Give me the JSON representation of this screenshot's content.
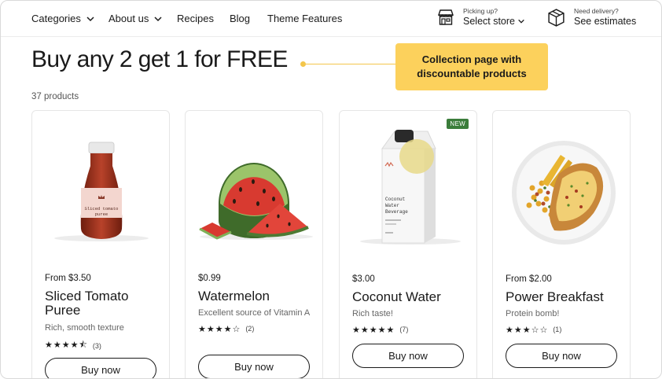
{
  "nav": {
    "items": [
      {
        "label": "Categories",
        "dropdown": true
      },
      {
        "label": "About us",
        "dropdown": true
      },
      {
        "label": "Recipes",
        "dropdown": false
      },
      {
        "label": "Blog",
        "dropdown": false
      },
      {
        "label": "Theme Features",
        "dropdown": false
      }
    ],
    "pickup": {
      "small": "Picking up?",
      "big": "Select store",
      "icon": "store-icon"
    },
    "delivery": {
      "small": "Need delivery?",
      "big": "See estimates",
      "icon": "box-icon"
    }
  },
  "collection": {
    "title": "Buy any 2 get 1 for FREE",
    "count": "37 products",
    "callout": "Collection page with discountable products",
    "callout_color": "#fcd15c"
  },
  "products": [
    {
      "price": "From $3.50",
      "name": "Sliced Tomato Puree",
      "description": "Rich, smooth texture",
      "stars": "★★★★⯪",
      "rating_count": "(3)",
      "button": "Buy now",
      "badge": ""
    },
    {
      "price": "$0.99",
      "name": "Watermelon",
      "description": "Excellent source of Vitamin A",
      "stars": "★★★★☆",
      "rating_count": "(2)",
      "button": "Buy now",
      "badge": ""
    },
    {
      "price": "$3.00",
      "name": "Coconut Water",
      "description": "Rich taste!",
      "stars": "★★★★★",
      "rating_count": "(7)",
      "button": "Buy now",
      "badge": "NEW"
    },
    {
      "price": "From $2.00",
      "name": "Power Breakfast",
      "description": "Protein bomb!",
      "stars": "★★★☆☆",
      "rating_count": "(1)",
      "button": "Buy now",
      "badge": ""
    }
  ],
  "product_images": {
    "tomato_label_line1": "Sliced tomato",
    "tomato_label_line2": "puree",
    "coconut_label_line1": "Coconut",
    "coconut_label_line2": "Water",
    "coconut_label_line3": "Beverage"
  }
}
